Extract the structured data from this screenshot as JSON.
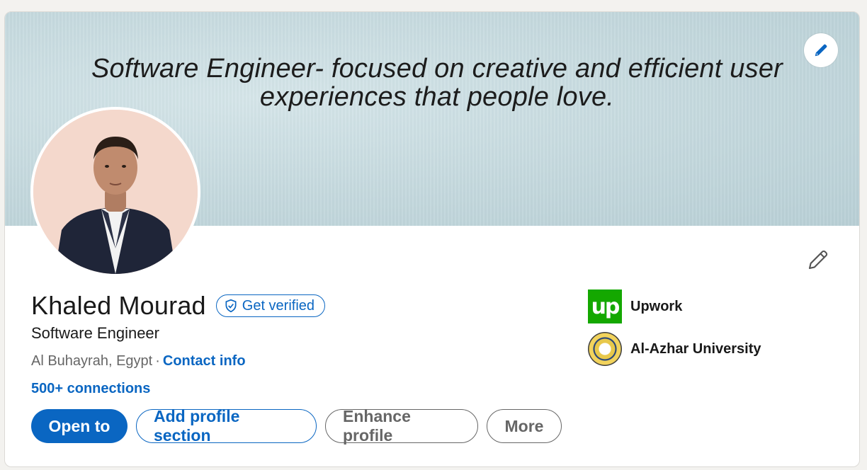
{
  "banner": {
    "line1": "Software Engineer- focused on creative and efficient user",
    "line2": "experiences that people love."
  },
  "profile": {
    "name": "Khaled Mourad",
    "verify_label": "Get verified",
    "headline": "Software Engineer",
    "location": "Al Buhayrah, Egypt",
    "separator": "·",
    "contact_label": "Contact info",
    "connections": "500+ connections"
  },
  "actions": {
    "open_to": "Open to",
    "add_section": "Add profile section",
    "enhance": "Enhance profile",
    "more": "More"
  },
  "orgs": [
    {
      "name": "Upwork",
      "logo": "up"
    },
    {
      "name": "Al-Azhar University",
      "logo": "al-azhar-seal"
    }
  ],
  "colors": {
    "accent": "#0a66c2",
    "upwork": "#14a800",
    "text": "#191919",
    "muted": "#666666"
  },
  "icons": {
    "banner_edit": "pencil-icon",
    "profile_edit": "pencil-icon",
    "verify": "shield-check-icon"
  }
}
